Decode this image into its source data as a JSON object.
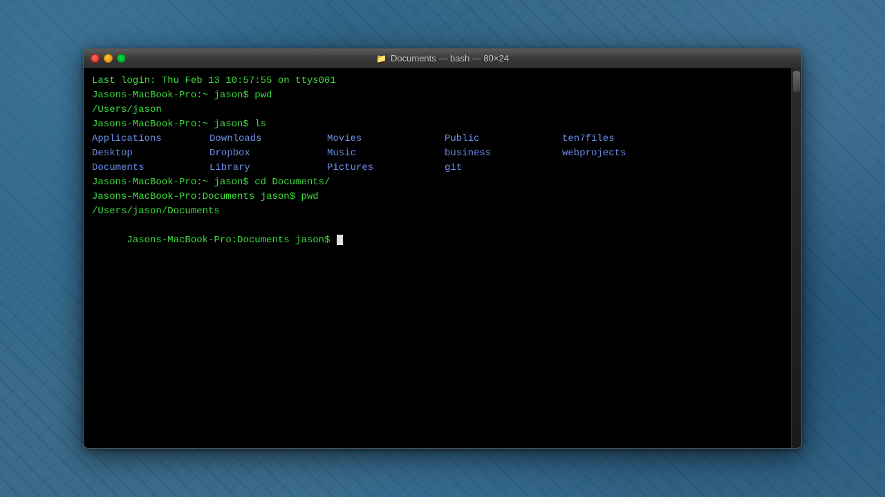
{
  "window": {
    "title": "Documents — bash — 80×24",
    "title_icon": "📁"
  },
  "terminal": {
    "lines": [
      {
        "id": "login",
        "text": "Last login: Thu Feb 13 10:57:55 on ttys001",
        "color": "green"
      },
      {
        "id": "prompt1",
        "text": "Jasons-MacBook-Pro:~ jason$ pwd",
        "color": "green"
      },
      {
        "id": "pwd1_output",
        "text": "/Users/jason",
        "color": "green"
      },
      {
        "id": "prompt2",
        "text": "Jasons-MacBook-Pro:~ jason$ ls",
        "color": "green"
      },
      {
        "id": "prompt3",
        "text": "Jasons-MacBook-Pro:~ jason$ cd Documents/",
        "color": "green"
      },
      {
        "id": "prompt4",
        "text": "Jasons-MacBook-Pro:Documents jason$ pwd",
        "color": "green"
      },
      {
        "id": "pwd2_output",
        "text": "/Users/jason/Documents",
        "color": "green"
      },
      {
        "id": "prompt5",
        "text": "Jasons-MacBook-Pro:Documents jason$ ",
        "color": "green"
      }
    ],
    "ls_items": {
      "row1": [
        "Applications",
        "Downloads",
        "Movies",
        "Public",
        "ten7files"
      ],
      "row2": [
        "Desktop",
        "Dropbox",
        "Music",
        "business",
        "webprojects"
      ],
      "row3": [
        "Documents",
        "Library",
        "Pictures",
        "git",
        ""
      ]
    }
  }
}
